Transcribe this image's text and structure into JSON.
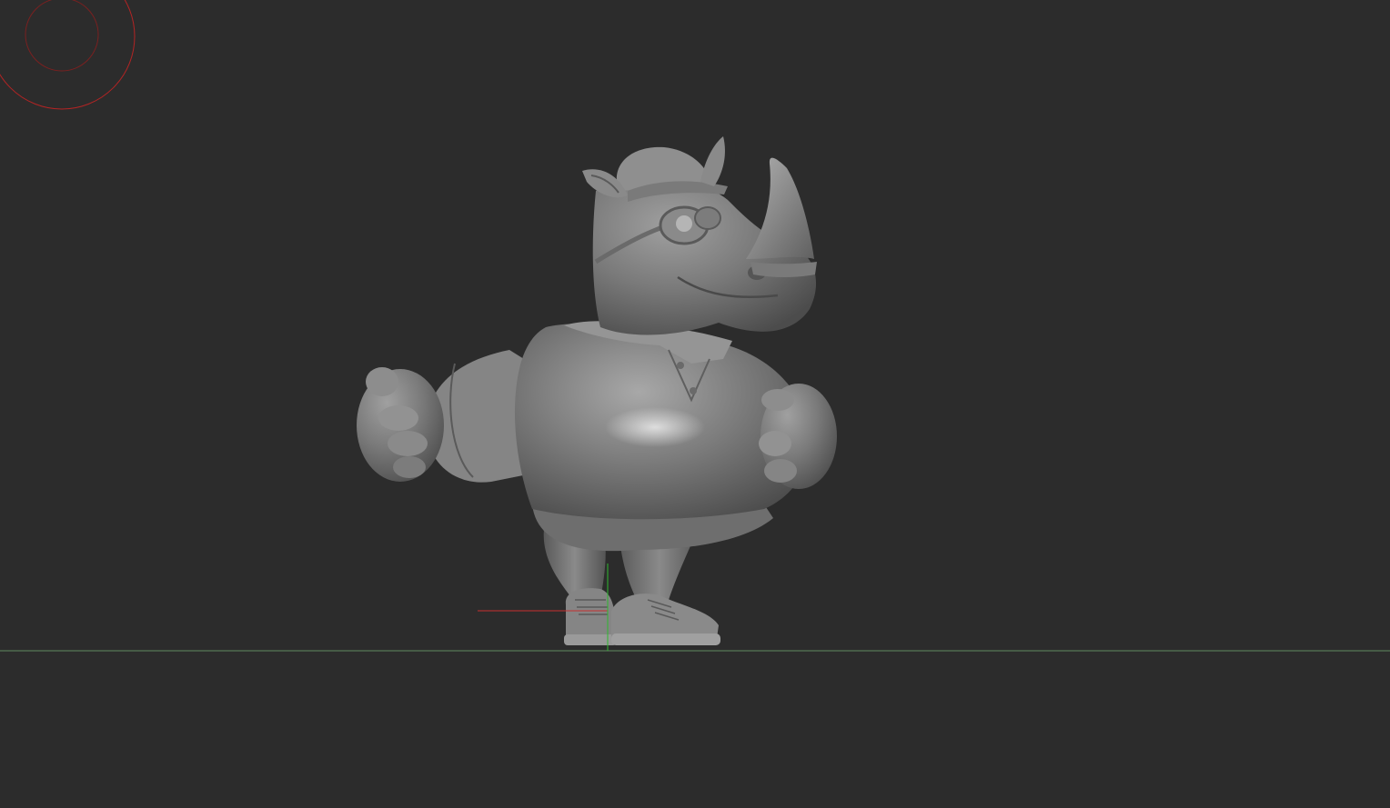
{
  "viewport": {
    "background": "#2c2c2c",
    "model": "rhino-character-sculpt",
    "gizmo_color": "#b32424",
    "floor_line_color": "#5f8a5f",
    "axis_x_color": "#c83030",
    "axis_y_color": "#2fb82f",
    "sculpt_base_color": "#7f7f7f",
    "sculpt_highlight_color": "#bdbdbd",
    "sculpt_shadow_color": "#3e3e3e"
  }
}
